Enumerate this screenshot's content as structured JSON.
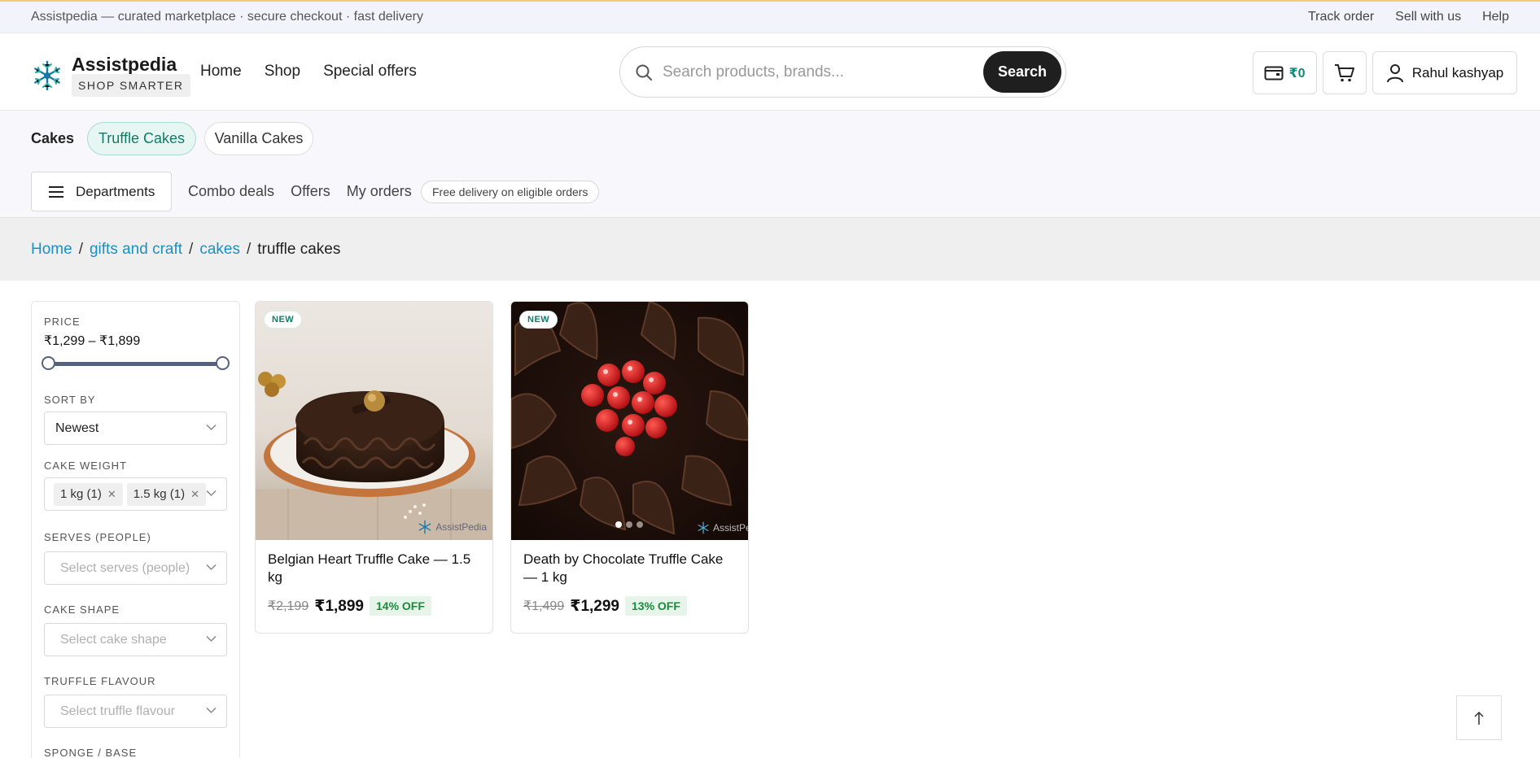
{
  "announcement": {
    "text": "Assistpedia — curated marketplace · secure checkout · fast delivery",
    "links": [
      "Track order",
      "Sell with us",
      "Help"
    ]
  },
  "header": {
    "brand_name": "Assistpedia",
    "brand_tagline": "SHOP SMARTER",
    "nav": [
      "Home",
      "Shop",
      "Special offers"
    ],
    "search_placeholder": "Search products, brands...",
    "search_button": "Search",
    "wallet_amount": "₹0",
    "user_name": "Rahul kashyap"
  },
  "category_bar": {
    "title": "Cakes",
    "chips": [
      "Truffle Cakes",
      "Vanilla Cakes"
    ],
    "departments_label": "Departments",
    "links": [
      "Combo deals",
      "Offers",
      "My orders"
    ],
    "delivery_note": "Free delivery on eligible orders"
  },
  "breadcrumb": {
    "items": [
      "Home",
      "gifts and craft",
      "cakes"
    ],
    "current": "truffle cakes"
  },
  "filters": {
    "price_label": "PRICE",
    "price_range": "₹1,299 – ₹1,899",
    "price_min_fraction": 0,
    "price_max_fraction": 1,
    "sort_label": "SORT BY",
    "sort_value": "Newest",
    "weight_label": "CAKE WEIGHT",
    "weight_tags": [
      "1 kg (1)",
      "1.5 kg (1)"
    ],
    "serves_label": "SERVES (PEOPLE)",
    "serves_placeholder": "Select serves (people)",
    "shape_label": "CAKE SHAPE",
    "shape_placeholder": "Select cake shape",
    "flavour_label": "TRUFFLE FLAVOUR",
    "flavour_placeholder": "Select truffle flavour",
    "sponge_label": "SPONGE / BASE"
  },
  "products": [
    {
      "badge": "NEW",
      "title": "Belgian Heart Truffle Cake — 1.5 kg",
      "mrp": "₹2,199",
      "price": "₹1,899",
      "discount": "14% OFF",
      "watermark": "AssistPedia"
    },
    {
      "badge": "NEW",
      "title": "Death by Chocolate Truffle Cake — 1 kg",
      "mrp": "₹1,499",
      "price": "₹1,299",
      "discount": "13% OFF",
      "watermark": "AssistPedia"
    }
  ],
  "colors": {
    "accent_teal": "#127a66",
    "link_blue": "#1a90c4",
    "discount_green": "#1b8a3a",
    "dark_button": "#1f1f1f"
  },
  "icons": [
    "snowflake-logo-icon",
    "search-icon",
    "wallet-icon",
    "cart-icon",
    "user-icon",
    "menu-icon",
    "chevron-down-icon",
    "close-icon",
    "arrow-up-icon"
  ]
}
